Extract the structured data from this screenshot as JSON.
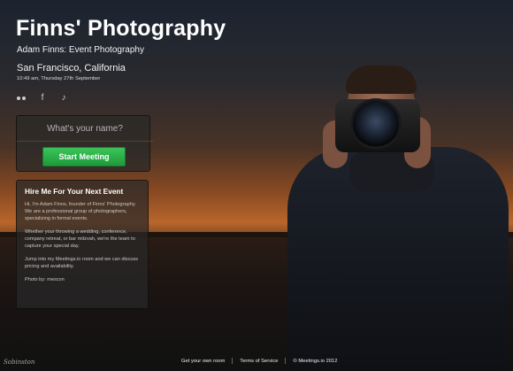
{
  "header": {
    "title": "Finns' Photography",
    "subtitle": "Adam Finns: Event Photography",
    "location": "San Francisco, California",
    "datetime": "10:49 am, Thursday 27th September"
  },
  "social": {
    "items": [
      {
        "name": "flickr",
        "glyph": ""
      },
      {
        "name": "facebook",
        "glyph": "f"
      },
      {
        "name": "twitter",
        "glyph": "♪"
      }
    ]
  },
  "meeting": {
    "name_placeholder": "What's your name?",
    "start_label": "Start Meeting"
  },
  "info": {
    "heading": "Hire Me For Your Next Event",
    "paragraphs": [
      "Hi, I'm Adam Finns, founder of Finns' Photography. We are a professional group of photographers, specializing in formal events.",
      "Whether your throwing a wedding, conference, company retreat, or bar mitzvah, we're the team to capture your special day.",
      "Jump into my Meetings.io room and we can discuss pricing and availability.",
      "Photo by: mescon"
    ]
  },
  "footer": {
    "link1": "Get your own room",
    "link2": "Terms of Service",
    "copyright": "© Meetings.io 2012"
  },
  "watermark": "Sobinston",
  "colors": {
    "accent_green": "#2fb24b"
  }
}
